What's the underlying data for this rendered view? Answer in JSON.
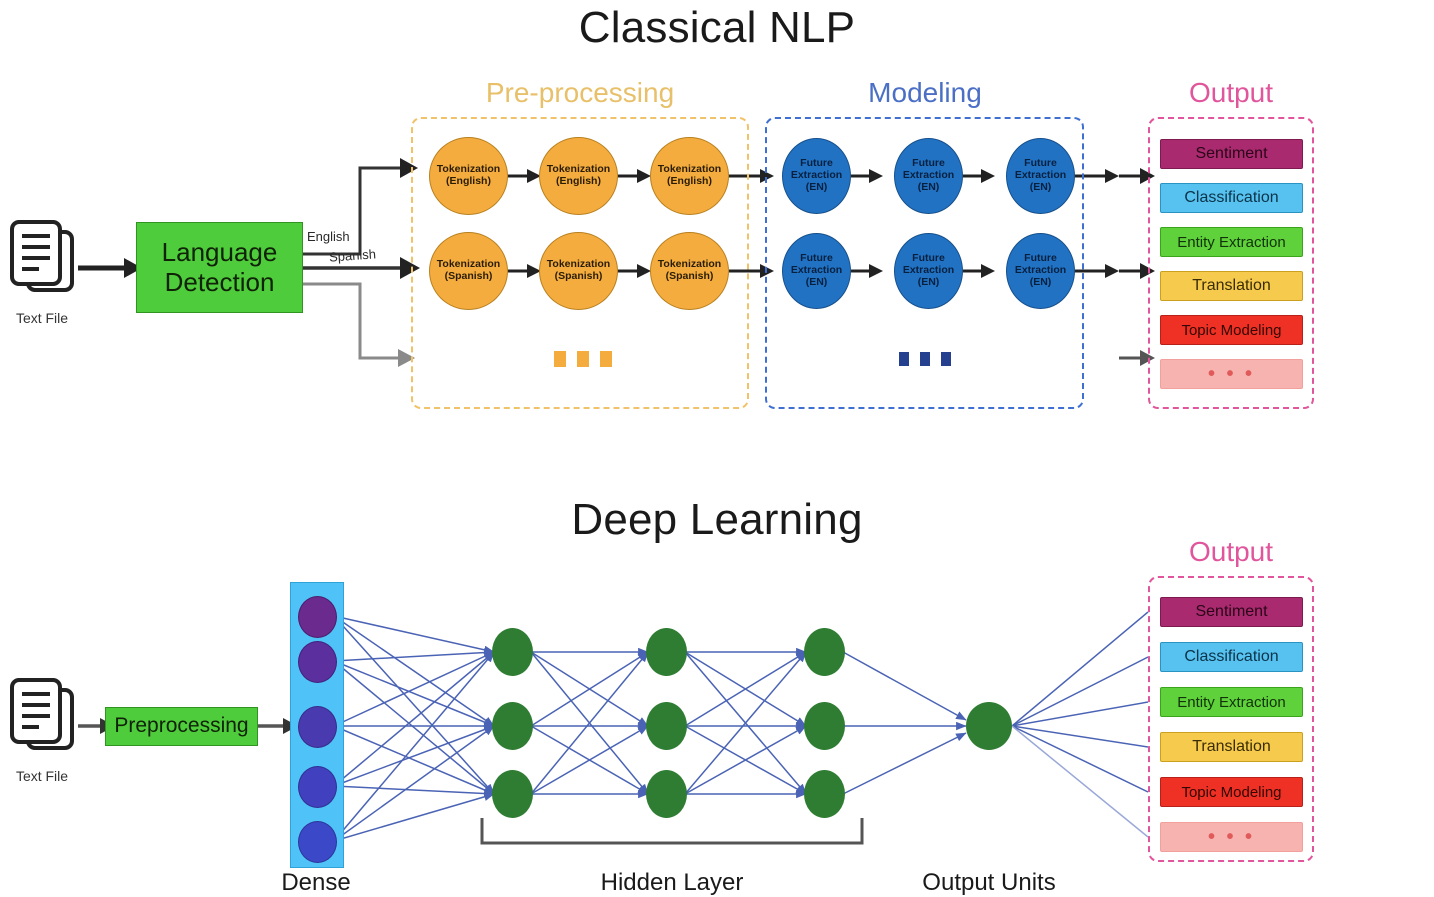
{
  "sections": [
    {
      "id": "classical",
      "title": "Classical NLP"
    },
    {
      "id": "deep",
      "title": "Deep Learning"
    }
  ],
  "classical": {
    "title": "Classical NLP",
    "input": {
      "icon": "document-icon",
      "label": "Text File"
    },
    "stage_box": {
      "label": "Language\nDetection",
      "line1": "Language",
      "line2": "Detection",
      "color": "#4fcc3c"
    },
    "branch_labels": {
      "english": "English",
      "spanish": "Spanish"
    },
    "groups": [
      {
        "name": "preprocessing",
        "title": "Pre-processing",
        "title_color": "#e8c06a",
        "frame_color": "#f0c36a"
      },
      {
        "name": "modeling",
        "title": "Modeling",
        "title_color": "#4a6fc4",
        "frame_color": "#3f6fd1"
      },
      {
        "name": "output",
        "title": "Output",
        "title_color": "#e0559b",
        "frame_color": "#e0559b"
      }
    ],
    "preprocessing": {
      "rows": [
        {
          "lang": "English",
          "nodes": [
            {
              "line1": "Tokenization",
              "line2": "(English)"
            },
            {
              "line1": "Tokenization",
              "line2": "(English)"
            },
            {
              "line1": "Tokenization",
              "line2": "(English)"
            }
          ]
        },
        {
          "lang": "Spanish",
          "nodes": [
            {
              "line1": "Tokenization",
              "line2": "(Spanish)"
            },
            {
              "line1": "Tokenization",
              "line2": "(Spanish)"
            },
            {
              "line1": "Tokenization",
              "line2": "(Spanish)"
            }
          ]
        }
      ],
      "ellipsis": "▪ ▪ ▪",
      "node_color": "#f5ac3f"
    },
    "modeling": {
      "rows": [
        {
          "nodes": [
            {
              "line1": "Future",
              "line2": "Extraction",
              "line3": "(EN)"
            },
            {
              "line1": "Future",
              "line2": "Extraction",
              "line3": "(EN)"
            },
            {
              "line1": "Future",
              "line2": "Extraction",
              "line3": "(EN)"
            }
          ]
        },
        {
          "nodes": [
            {
              "line1": "Future",
              "line2": "Extraction",
              "line3": "(EN)"
            },
            {
              "line1": "Future",
              "line2": "Extraction",
              "line3": "(EN)"
            },
            {
              "line1": "Future",
              "line2": "Extraction",
              "line3": "(EN)"
            }
          ]
        }
      ],
      "ellipsis": "▪ ▪ ▪",
      "node_color": "#2272c4"
    },
    "output": {
      "title": "Output",
      "chips": [
        {
          "label": "Sentiment",
          "bg": "#a92a6e",
          "fg": "#2a0618",
          "border": "#7d1b51"
        },
        {
          "label": "Classification",
          "bg": "#57c2ef",
          "fg": "#0b3349",
          "border": "#2b93c2"
        },
        {
          "label": "Entity Extraction",
          "bg": "#5fd13a",
          "fg": "#11320a",
          "border": "#3aa51c"
        },
        {
          "label": "Translation",
          "bg": "#f6cb4d",
          "fg": "#3a2c05",
          "border": "#c9a11f"
        },
        {
          "label": "Topic Modeling",
          "bg": "#ee3124",
          "fg": "#330703",
          "border": "#b8211a"
        },
        {
          "label": "• • •",
          "bg": "#f7b3b0",
          "fg": "#e05a5a",
          "border": "#f2a09c",
          "is_ellipsis": true
        }
      ]
    }
  },
  "deep": {
    "title": "Deep Learning",
    "input": {
      "icon": "document-icon",
      "label": "Text File"
    },
    "preprocessing_box": {
      "label": "Preprocessing",
      "color": "#4fcc3c"
    },
    "layer_labels": {
      "dense": "Dense",
      "hidden": "Hidden Layer",
      "output_units": "Output Units"
    },
    "dense": {
      "units": 5,
      "band_color": "#4fc3f7",
      "node_colors": [
        "#6b2a8e",
        "#5b2f9e",
        "#4a3ab0",
        "#4141bf",
        "#3b49c9"
      ]
    },
    "hidden": {
      "layers": 3,
      "units_per_layer": 3,
      "node_color": "#2e7d32"
    },
    "output_units": {
      "units": 1,
      "node_color": "#2e7d32"
    },
    "edge_color": "#4a63b5",
    "output": {
      "title": "Output",
      "chips": [
        {
          "label": "Sentiment",
          "bg": "#a92a6e",
          "fg": "#2a0618",
          "border": "#7d1b51"
        },
        {
          "label": "Classification",
          "bg": "#57c2ef",
          "fg": "#0b3349",
          "border": "#2b93c2"
        },
        {
          "label": "Entity Extraction",
          "bg": "#5fd13a",
          "fg": "#11320a",
          "border": "#3aa51c"
        },
        {
          "label": "Translation",
          "bg": "#f6cb4d",
          "fg": "#3a2c05",
          "border": "#c9a11f"
        },
        {
          "label": "Topic Modeling",
          "bg": "#ee3124",
          "fg": "#330703",
          "border": "#b8211a"
        },
        {
          "label": "• • •",
          "bg": "#f7b3b0",
          "fg": "#e05a5a",
          "border": "#f2a09c",
          "is_ellipsis": true
        }
      ]
    }
  },
  "colors": {
    "arrow_dark": "#222222",
    "arrow_gray": "#808080",
    "green": "#4fcc3c",
    "orange": "#f5ac3f",
    "blue": "#2272c4",
    "pink": "#e0559b",
    "net_edge": "#4a63b5"
  }
}
